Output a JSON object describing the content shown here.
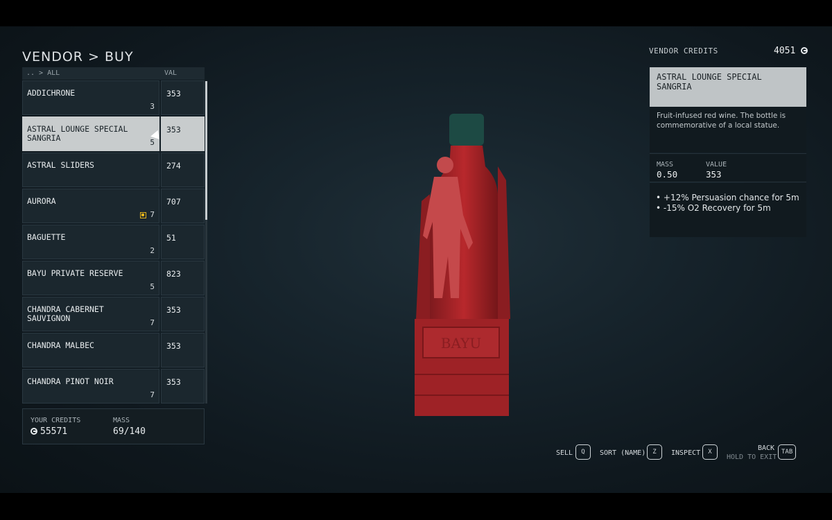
{
  "page_title": "VENDOR > BUY",
  "list": {
    "breadcrumb": ".. > ALL",
    "val_header": "VAL",
    "items": [
      {
        "name": "ADDICHRONE",
        "qty": "3",
        "val": "353",
        "badge": false
      },
      {
        "name": "ASTRAL LOUNGE SPECIAL SANGRIA",
        "qty": "5",
        "val": "353",
        "badge": false,
        "selected": true
      },
      {
        "name": "ASTRAL SLIDERS",
        "qty": "",
        "val": "274",
        "badge": false
      },
      {
        "name": "AURORA",
        "qty": "7",
        "val": "707",
        "badge": true
      },
      {
        "name": "BAGUETTE",
        "qty": "2",
        "val": "51",
        "badge": false
      },
      {
        "name": "BAYU PRIVATE RESERVE",
        "qty": "5",
        "val": "823",
        "badge": false
      },
      {
        "name": "CHANDRA CABERNET SAUVIGNON",
        "qty": "7",
        "val": "353",
        "badge": false
      },
      {
        "name": "CHANDRA MALBEC",
        "qty": "",
        "val": "353",
        "badge": false
      },
      {
        "name": "CHANDRA PINOT NOIR",
        "qty": "7",
        "val": "353",
        "badge": false
      }
    ]
  },
  "footer": {
    "credits_label": "YOUR CREDITS",
    "credits_value": "55571",
    "mass_label": "MASS",
    "mass_value": "69/140"
  },
  "vendor_credits": {
    "label": "VENDOR CREDITS",
    "value": "4051"
  },
  "detail": {
    "title": "ASTRAL LOUNGE SPECIAL SANGRIA",
    "description": "Fruit-infused red wine. The bottle is commemorative of a local statue.",
    "mass_label": "MASS",
    "mass_value": "0.50",
    "value_label": "VALUE",
    "value_value": "353",
    "effects": [
      "+12% Persuasion chance for 5m",
      "-15% O2 Recovery for 5m"
    ]
  },
  "bottle_label": "BAYU",
  "hints": {
    "sell_label": "SELL",
    "sell_key": "Q",
    "sort_label": "SORT (NAME)",
    "sort_key": "Z",
    "inspect_label": "INSPECT",
    "inspect_key": "X",
    "back_label": "BACK",
    "back_sub": "HOLD TO EXIT",
    "back_key": "TAB"
  },
  "colors": {
    "accent_badge": "#e3b21c",
    "selected_row": "#c8cccd",
    "bottle_red": "#b3262a"
  }
}
